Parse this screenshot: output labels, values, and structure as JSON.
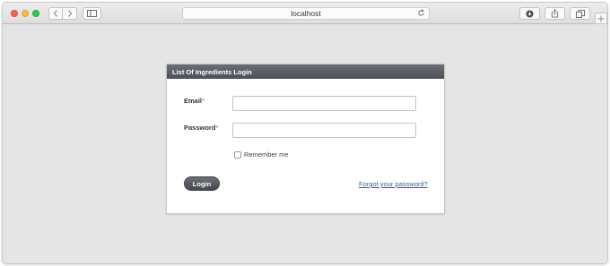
{
  "browser": {
    "address": "localhost",
    "icons": {
      "back": "chevron-left-icon",
      "forward": "chevron-right-icon",
      "sidebar": "sidebar-icon",
      "reload": "reload-icon",
      "download": "download-icon",
      "share": "share-icon",
      "tabs": "tabs-icon",
      "new_tab": "plus-icon"
    }
  },
  "login": {
    "title": "List Of Ingredients Login",
    "email_label": "Email",
    "password_label": "Password",
    "required_marker": "*",
    "remember_label": "Remember me",
    "login_button": "Login",
    "forgot_link": "Forgot your password?"
  },
  "colors": {
    "header": "#4c5157",
    "link": "#3c5a8a",
    "required": "#d9534f"
  }
}
